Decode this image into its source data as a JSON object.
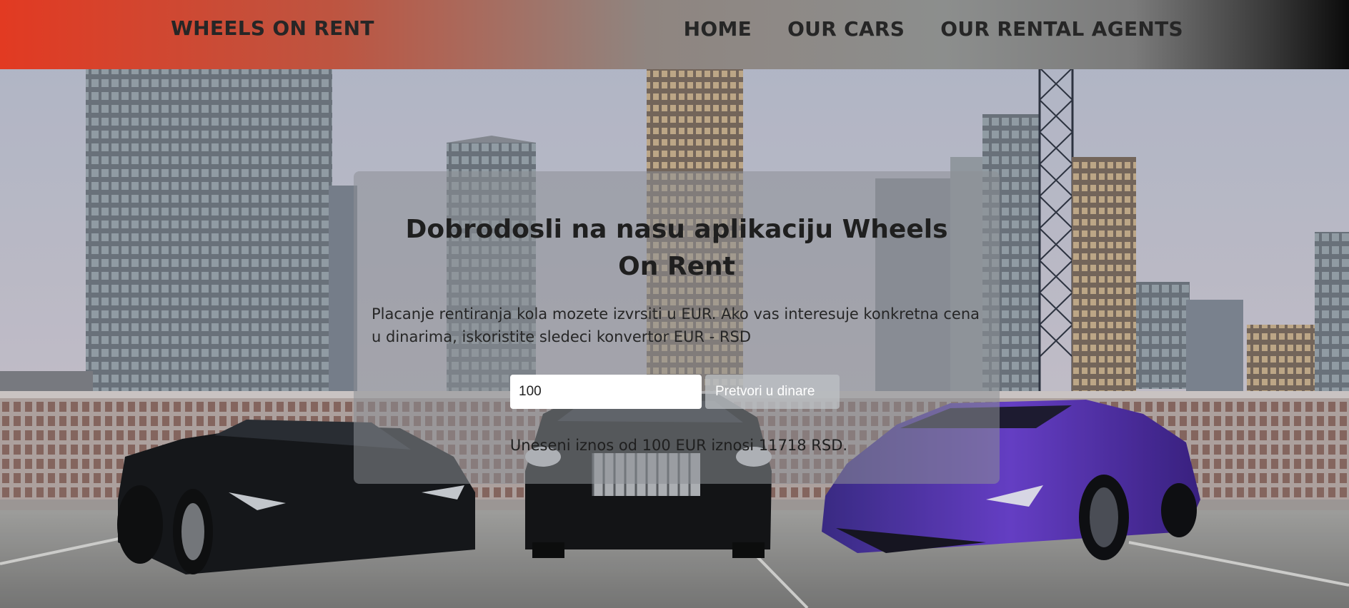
{
  "navbar": {
    "brand": "WHEELS ON RENT",
    "links": [
      {
        "label": "HOME"
      },
      {
        "label": "OUR CARS"
      },
      {
        "label": "OUR RENTAL AGENTS"
      }
    ]
  },
  "panel": {
    "title": "Dobrodosli na nasu aplikaciju Wheels On Rent",
    "description": "Placanje rentiranja kola mozete izvrsiti u EUR. Ako vas interesuje konkretna cena u dinarima, iskoristite sledeci konvertor EUR - RSD",
    "converter": {
      "input_value": "100",
      "button_label": "Pretvori u dinare"
    },
    "result": "Uneseni iznos od 100 EUR iznosi 11718 RSD."
  },
  "colors": {
    "nav_gradient_start": "#e23a22",
    "nav_gradient_end": "#0b0b0b",
    "text_dark": "#262626",
    "panel_overlay": "rgba(140,144,150,0.55)"
  }
}
